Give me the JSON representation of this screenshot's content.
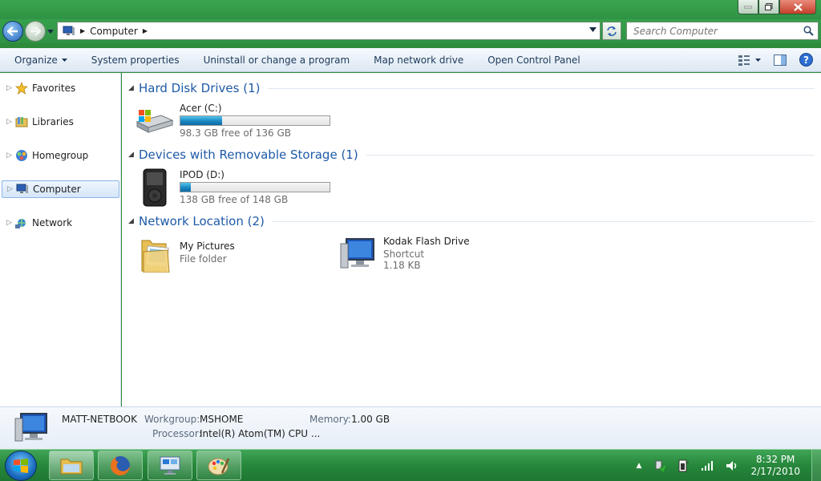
{
  "address": {
    "crumb": "Computer"
  },
  "search": {
    "placeholder": "Search Computer"
  },
  "command_bar": {
    "organize": "Organize",
    "system_properties": "System properties",
    "uninstall": "Uninstall or change a program",
    "map_drive": "Map network drive",
    "control_panel": "Open Control Panel"
  },
  "nav": {
    "favorites": "Favorites",
    "libraries": "Libraries",
    "homegroup": "Homegroup",
    "computer": "Computer",
    "network": "Network"
  },
  "groups": {
    "hdd": "Hard Disk Drives (1)",
    "removable": "Devices with Removable Storage (1)",
    "network": "Network Location (2)"
  },
  "drives": {
    "c": {
      "name": "Acer (C:)",
      "free": "98.3 GB free of 136 GB",
      "used_fraction": 0.28
    },
    "d": {
      "name": "IPOD (D:)",
      "free": "138 GB free of 148 GB",
      "used_fraction": 0.07
    }
  },
  "network_items": {
    "pictures": {
      "name": "My Pictures",
      "type": "File folder"
    },
    "kodak": {
      "name": "Kodak Flash Drive",
      "type": "Shortcut",
      "size": "1.18 KB"
    }
  },
  "details": {
    "name": "MATT-NETBOOK",
    "workgroup_label": "Workgroup:",
    "workgroup": "MSHOME",
    "memory_label": "Memory:",
    "memory": "1.00 GB",
    "processor_label": "Processor:",
    "processor": "Intel(R) Atom(TM) CPU ..."
  },
  "clock": {
    "time": "8:32 PM",
    "date": "2/17/2010"
  },
  "colors": {
    "accent": "#1e5aa8",
    "taskbar": "#2e8b3a",
    "bar_fill": "#1a87c1"
  }
}
